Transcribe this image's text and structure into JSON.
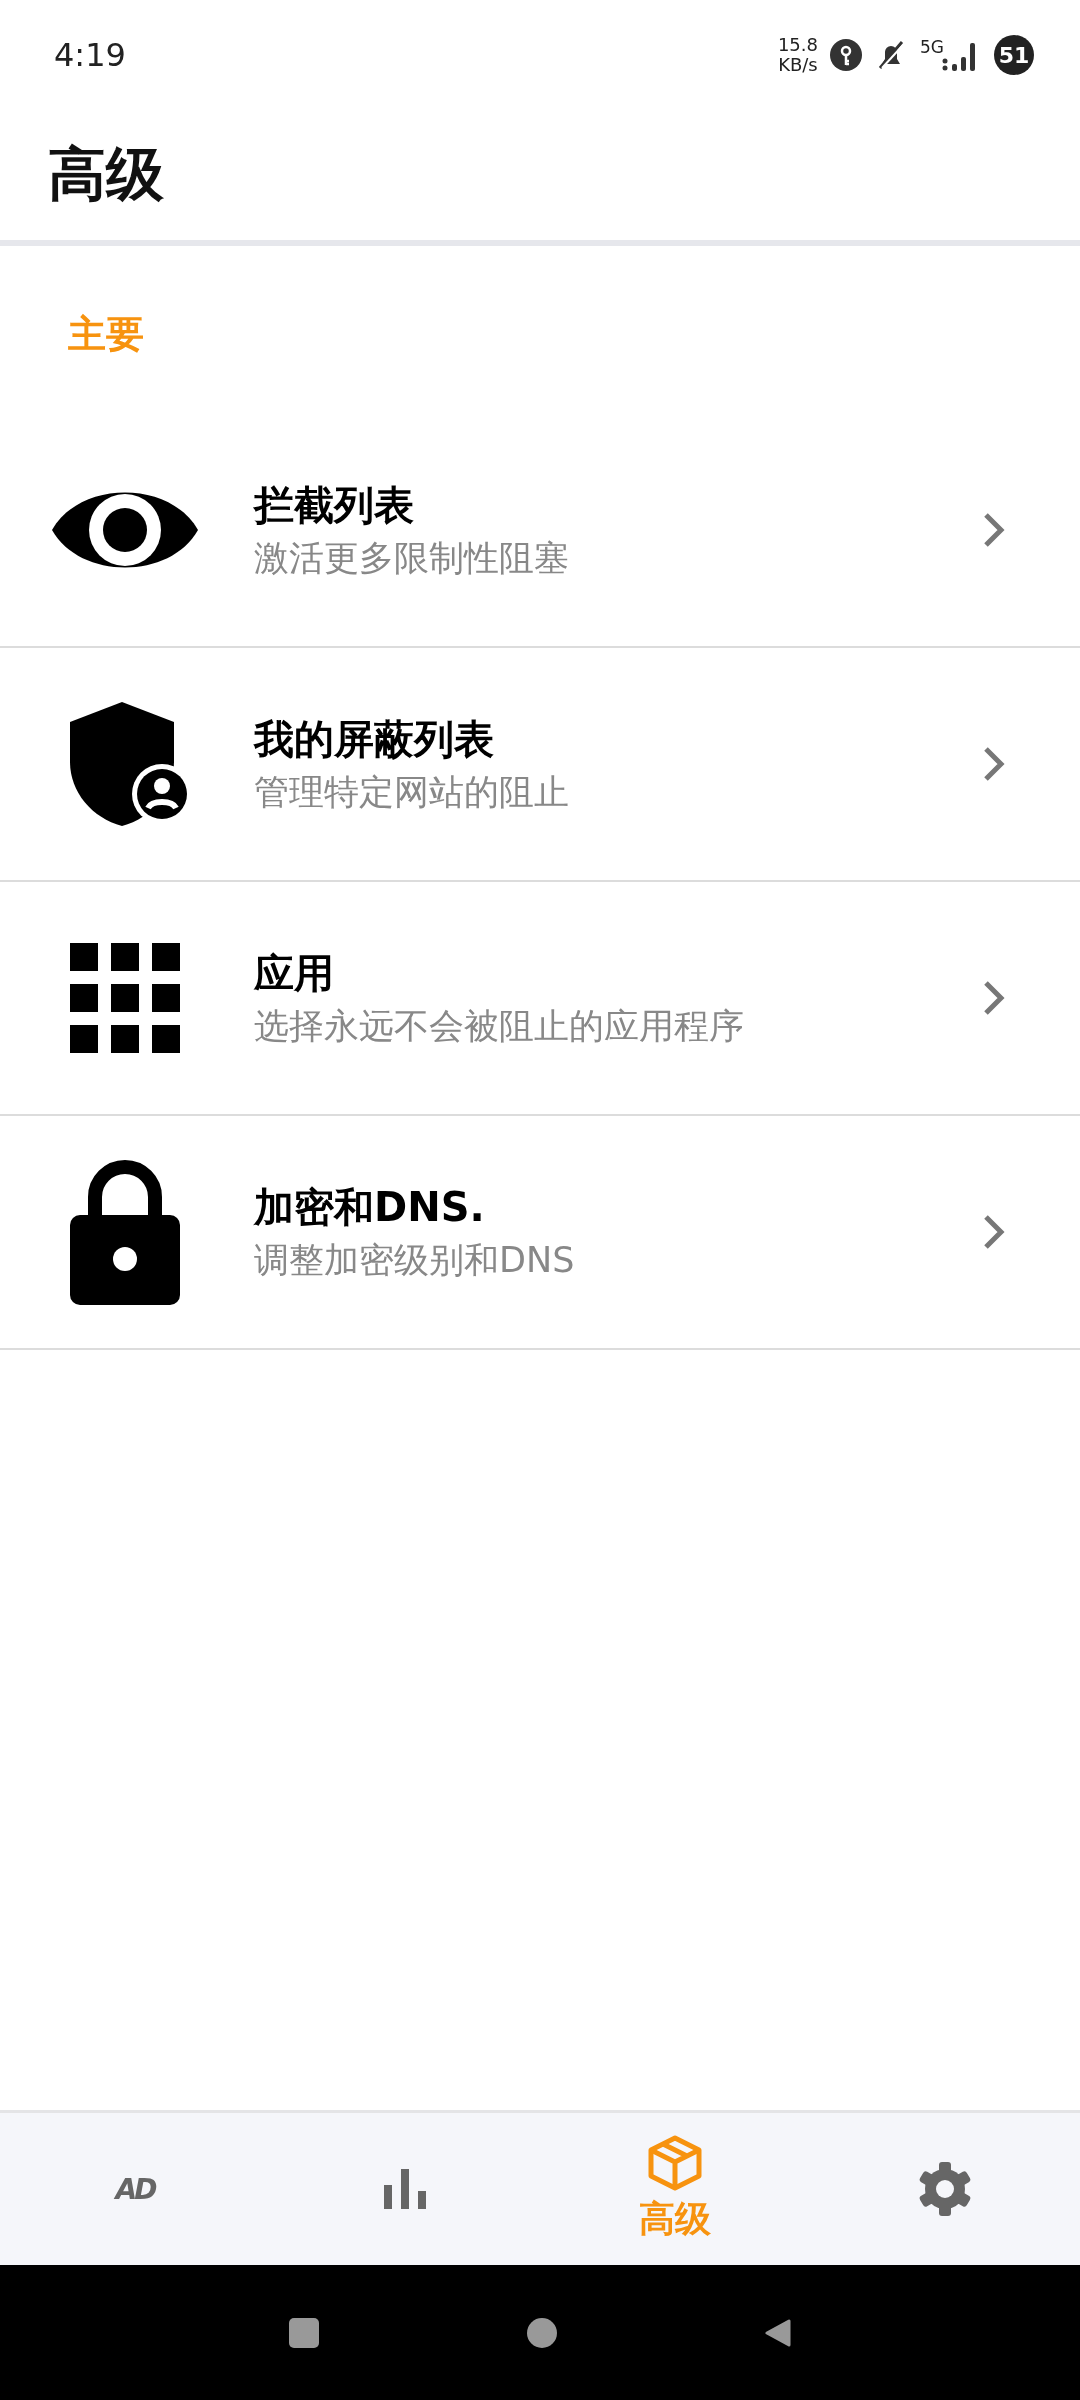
{
  "status_bar": {
    "time": "4:19",
    "net_speed": "15.8",
    "net_unit": "KB/s",
    "network": "5G",
    "battery": "51"
  },
  "header": {
    "title": "高级"
  },
  "section": {
    "title": "主要"
  },
  "items": [
    {
      "title": "拦截列表",
      "subtitle": "激活更多限制性阻塞"
    },
    {
      "title": "我的屏蔽列表",
      "subtitle": "管理特定网站的阻止"
    },
    {
      "title": "应用",
      "subtitle": "选择永远不会被阻止的应用程序"
    },
    {
      "title": "加密和DNS.",
      "subtitle": "调整加密级别和DNS"
    }
  ],
  "bottom_nav": [
    {
      "kind": "logo",
      "text": "AD",
      "selected": false
    },
    {
      "kind": "icon",
      "selected": false
    },
    {
      "kind": "icon",
      "label": "高级",
      "selected": true
    },
    {
      "kind": "icon",
      "selected": false
    }
  ]
}
